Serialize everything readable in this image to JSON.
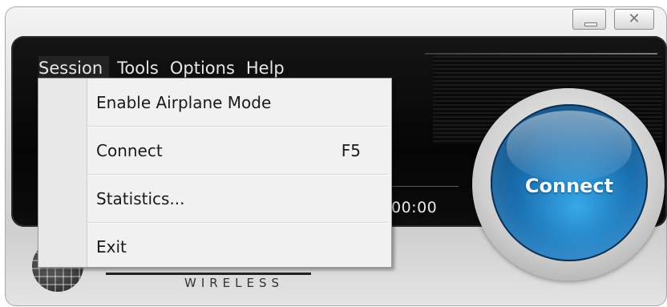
{
  "window": {
    "minimize_icon": "minimize-icon",
    "close_icon": "close-icon"
  },
  "menubar": {
    "items": [
      {
        "label": "Session"
      },
      {
        "label": "Tools"
      },
      {
        "label": "Options"
      },
      {
        "label": "Help"
      }
    ]
  },
  "session_menu": {
    "items": [
      {
        "label": "Enable Airplane Mode",
        "shortcut": ""
      },
      {
        "label": "Connect",
        "shortcut": "F5"
      },
      {
        "label": "Statistics...",
        "shortcut": ""
      },
      {
        "label": "Exit",
        "shortcut": ""
      }
    ]
  },
  "status": {
    "timer": "00:00"
  },
  "connect_button": {
    "label": "Connect"
  },
  "logo": {
    "subtitle": "WIRELESS"
  },
  "colors": {
    "accent_blue": "#1a6fb0",
    "panel_dark": "#0a0a0a"
  }
}
